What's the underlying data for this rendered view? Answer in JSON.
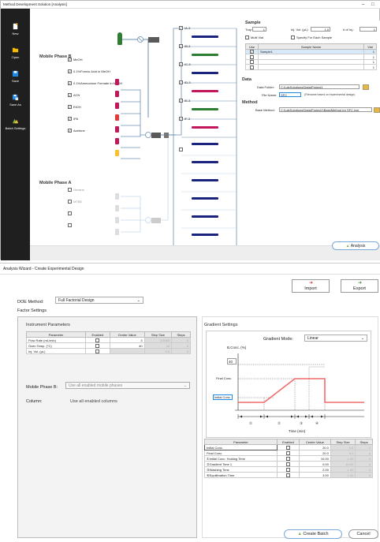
{
  "window1": {
    "title": "Method Development Solution [Analysis]",
    "controls": [
      "–",
      "□"
    ],
    "sidebar": [
      {
        "label": "New",
        "icon": "new-file-icon"
      },
      {
        "label": "Open",
        "icon": "folder-icon"
      },
      {
        "label": "Save",
        "icon": "save-icon"
      },
      {
        "label": "Save As",
        "icon": "save-as-icon"
      },
      {
        "label": "Batch Settings",
        "icon": "batch-settings-icon"
      }
    ],
    "mobile_phase_b": {
      "title": "Mobile Phase B",
      "solvents": [
        {
          "name": "MeOH",
          "checked": true,
          "color": "#c2185b"
        },
        {
          "name": "0.1%Formic Acid in MeOH",
          "checked": true,
          "color": "#c2185b"
        },
        {
          "name": "0.1%Ammonium Formate in MeOH",
          "checked": true,
          "color": "#c2185b"
        },
        {
          "name": "ACN",
          "checked": true,
          "color": "#e53935"
        },
        {
          "name": "EtOH",
          "checked": true,
          "color": "#c2185b"
        },
        {
          "name": "IPA",
          "checked": true,
          "color": "#c2185b"
        },
        {
          "name": "Acetone",
          "checked": true,
          "color": "#fbc02d"
        }
      ]
    },
    "mobile_phase_a": {
      "title": "Mobile Phase A",
      "solvents": [
        {
          "name": "Hexane",
          "checked": false
        },
        {
          "name": "MTBE",
          "checked": false
        },
        {
          "name": "",
          "checked": false
        },
        {
          "name": "",
          "checked": false
        }
      ]
    },
    "columns": [
      {
        "name": "IA-3",
        "checked": true
      },
      {
        "name": "IB-3",
        "checked": true
      },
      {
        "name": "IC-3",
        "checked": true
      },
      {
        "name": "ID-3",
        "checked": true
      },
      {
        "name": "IE-3",
        "checked": true
      },
      {
        "name": "IF-3",
        "checked": true
      },
      {
        "name": "",
        "checked": false
      }
    ],
    "sample": {
      "title": "Sample",
      "tray_label": "Tray:",
      "tray_value": "1",
      "inj_vol_label": "Inj. Vol. (µL):",
      "inj_vol_value": "1.0",
      "num_inj_label": "# of Inj.:",
      "num_inj_value": "1",
      "multi_vial_label": "Multi Vial",
      "specify_each_label": "Specify For Each Sample",
      "table_headers": [
        "Use",
        "Sample Name",
        "Vial"
      ],
      "rows": [
        {
          "use": true,
          "name": "Sample1",
          "vial": "1"
        },
        {
          "use": false,
          "name": "",
          "vial": "1"
        },
        {
          "use": false,
          "name": "",
          "vial": "1"
        },
        {
          "use": false,
          "name": "",
          "vial": "1"
        }
      ]
    },
    "data": {
      "title": "Data",
      "folder_label": "Data Folder:",
      "folder_value": "C:\\LabSolutions\\Data\\Project1",
      "filename_label": "File Name:",
      "filename_value": "SFC",
      "filename_hint": "(Filename based on experimental design)"
    },
    "method": {
      "title": "Method",
      "base_label": "Base Method:",
      "base_value": "C:\\LabSolutions\\Data\\Project1\\BaseMethod for SFC.lcm"
    },
    "analysis_button": "Analysis"
  },
  "window2": {
    "title": "Analysis Wizard - Create Experimental Design",
    "import_label": "Import",
    "export_label": "Export",
    "doe_method_label": "DOE Method:",
    "doe_method_value": "Full Factorial Design",
    "factor_settings_label": "Factor Settings",
    "instrument": {
      "title": "Instrument Parameters",
      "headers": [
        "Parameter",
        "Enabled",
        "Center Value",
        "Step Size",
        "Steps"
      ],
      "rows": [
        {
          "param": "Flow Rate (mL/min)",
          "center": "3",
          "step": "0.5000",
          "steps": "3"
        },
        {
          "param": "Oven Temp. (°C)",
          "center": "40",
          "step": "10",
          "steps": "3"
        },
        {
          "param": "Inj. Vol. (µL)",
          "center": "",
          "step": "5.0",
          "steps": "3"
        }
      ]
    },
    "mobile_phase_b_label": "Mobile Phase B:",
    "mobile_phase_b_value": "Use all enabled mobile phases",
    "column_label": "Column:",
    "column_value": "Use all enabled columns",
    "gradient": {
      "title": "Gradient Settings",
      "mode_label": "Gradient Mode:",
      "mode_value": "Linear",
      "bconc_label": "B.Conc. (%)",
      "bconc_value": "40",
      "final_label": "Final Conc.",
      "initial_label": "Initial Conc.",
      "time_label": "Time (min)",
      "marker_labels": [
        "①",
        "②",
        "③",
        "④"
      ],
      "headers": [
        "Parameter",
        "Enabled",
        "Center Value",
        "Step Size",
        "Steps"
      ],
      "rows": [
        {
          "param": "Initial Conc.",
          "center": "20.0",
          "step": "5.0",
          "steps": "3"
        },
        {
          "param": "Final Conc.",
          "center": "20.0",
          "step": "5.0",
          "steps": "3"
        },
        {
          "param": "①Initial Conc. Holding Time",
          "center": "10.00",
          "step": "1.00",
          "steps": "3"
        },
        {
          "param": "②Gradient Time 1",
          "center": "0.00",
          "step": "10.00",
          "steps": "3"
        },
        {
          "param": "③Washing Time",
          "center": "2.00",
          "step": "1.00",
          "steps": "3"
        },
        {
          "param": "④Equilibration Time",
          "center": "3.00",
          "step": "1.00",
          "steps": "3"
        }
      ]
    },
    "create_batch_label": "Create Batch",
    "cancel_label": "Cancel"
  }
}
